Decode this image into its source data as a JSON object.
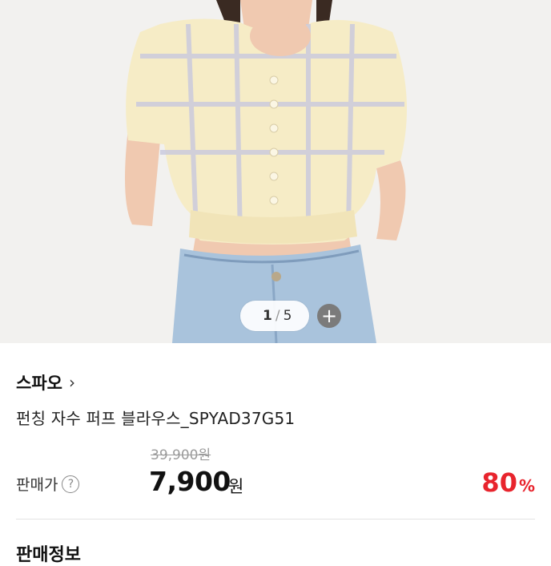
{
  "gallery": {
    "current": "1",
    "separator": "/",
    "total": "5",
    "more_icon": "plus-icon"
  },
  "product": {
    "brand": "스파오",
    "brand_chevron": "›",
    "name": "펀칭 자수 퍼프 블라우스_SPYAD37G51",
    "original_price": "39,900원",
    "price_label": "판매가",
    "price": "7,900",
    "price_unit": "원",
    "discount": "80",
    "discount_unit": "%",
    "help_icon": "?"
  },
  "next_section": {
    "title": "판매정보"
  },
  "colors": {
    "accent": "#e8242d"
  }
}
